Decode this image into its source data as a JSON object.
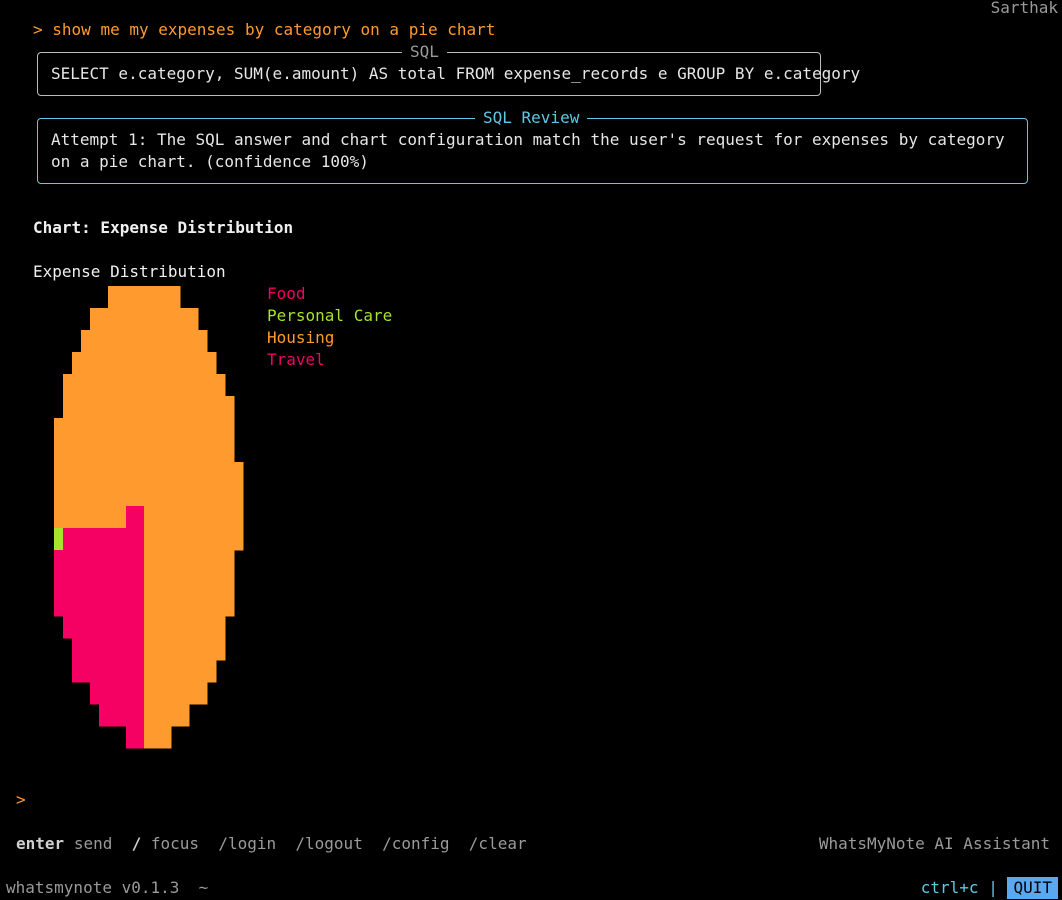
{
  "header": {
    "user": "Sarthak"
  },
  "prompt": {
    "caret": ">",
    "text": "show me my expenses by category on a pie chart"
  },
  "sql_box": {
    "title": "SQL",
    "query": "SELECT e.category, SUM(e.amount) AS total FROM expense_records e GROUP BY e.category"
  },
  "review_box": {
    "title": "SQL Review",
    "text": "Attempt 1: The SQL answer and chart configuration match the user's request for expenses by category on a pie chart. (confidence 100%)"
  },
  "chart": {
    "heading": "Chart: Expense Distribution",
    "title": "Expense Distribution"
  },
  "chart_data": {
    "type": "pie",
    "title": "Expense Distribution",
    "categories": [
      "Food",
      "Personal Care",
      "Housing",
      "Travel"
    ],
    "values": [
      20,
      1,
      79,
      0
    ],
    "colors": [
      "#f50063",
      "#a6e22e",
      "#ff9a2e",
      "#f50063"
    ],
    "legend_position": "right"
  },
  "input": {
    "caret": ">"
  },
  "help": {
    "enter_key": "enter",
    "send_label": "send",
    "focus_key": "/",
    "focus_label": "focus",
    "commands": [
      "/login",
      "/logout",
      "/config",
      "/clear"
    ]
  },
  "footer": {
    "app_name": "WhatsMyNote AI Assistant",
    "version": "whatsmynote v0.1.3",
    "cwd": "~",
    "ctrl_label": "ctrl+c",
    "separator": "|",
    "quit_label": "QUIT"
  }
}
